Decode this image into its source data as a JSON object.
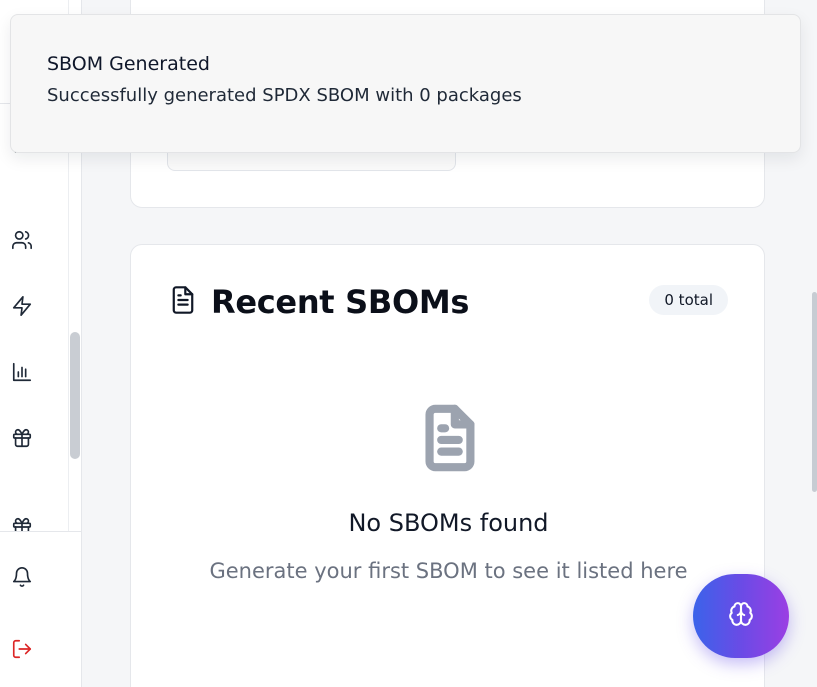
{
  "toast": {
    "title": "SBOM Generated",
    "description": "Successfully generated SPDX SBOM with 0 packages"
  },
  "recent": {
    "title": "Recent SBOMs",
    "total_badge": "0 total",
    "empty_title": "No SBOMs found",
    "empty_subtitle": "Generate your first SBOM to see it listed here"
  },
  "sidebar": {
    "icons": [
      "partial-icon",
      "users-icon",
      "zap-icon",
      "bar-chart-icon",
      "gift-icon",
      "partial-gift-icon",
      "bell-icon",
      "logout-icon"
    ]
  },
  "fab": {
    "icon": "brain-icon"
  },
  "colors": {
    "logout": "#dc2626",
    "fab_gradient_start": "#3b63ea",
    "fab_gradient_end": "#9b3fe3"
  }
}
